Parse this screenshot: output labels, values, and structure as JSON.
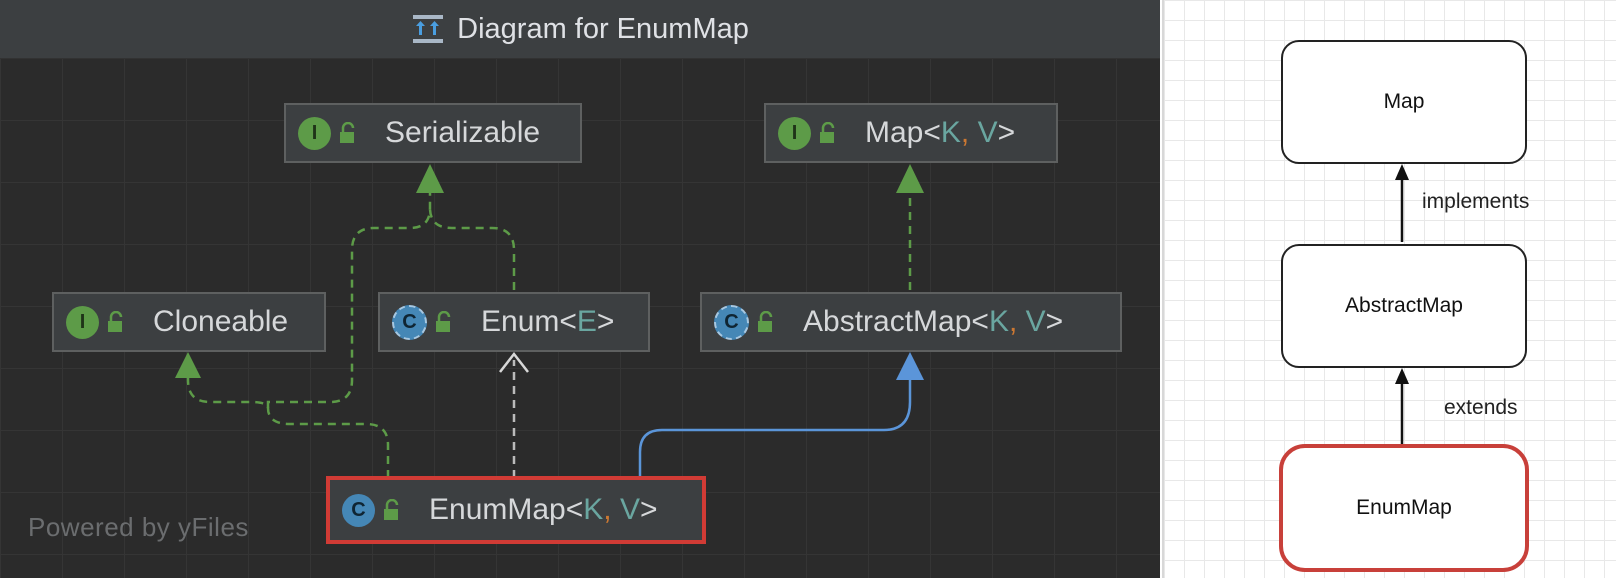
{
  "ide": {
    "title": "Diagram for EnumMap",
    "watermark": "Powered by yFiles",
    "nodes": {
      "serializable": {
        "kind": "interface",
        "badge": "I",
        "name": "Serializable"
      },
      "map": {
        "kind": "interface",
        "badge": "I",
        "name": "Map",
        "type_params": [
          "K",
          "V"
        ]
      },
      "cloneable": {
        "kind": "interface",
        "badge": "I",
        "name": "Cloneable"
      },
      "enum": {
        "kind": "abstract-class",
        "badge": "C",
        "name": "Enum",
        "type_params": [
          "E"
        ]
      },
      "abstractmap": {
        "kind": "abstract-class",
        "badge": "C",
        "name": "AbstractMap",
        "type_params": [
          "K",
          "V"
        ]
      },
      "enummap": {
        "kind": "class",
        "badge": "C",
        "name": "EnumMap",
        "type_params": [
          "K",
          "V"
        ],
        "selected": true
      }
    },
    "edges": [
      {
        "from": "enummap",
        "to": "cloneable",
        "style": "dashed",
        "color": "#5d9b48"
      },
      {
        "from": "enummap",
        "to": "serializable",
        "style": "dashed",
        "color": "#5d9b48"
      },
      {
        "from": "enum",
        "to": "serializable",
        "style": "dashed",
        "color": "#5d9b48"
      },
      {
        "from": "enummap",
        "to": "enum",
        "style": "dashed",
        "color": "#bbbbbb"
      },
      {
        "from": "abstractmap",
        "to": "map",
        "style": "dashed",
        "color": "#5d9b48"
      },
      {
        "from": "enummap",
        "to": "abstractmap",
        "style": "solid",
        "color": "#5b95d9"
      }
    ],
    "colors": {
      "background": "#2b2b2b",
      "interface_badge": "#5d9b48",
      "class_badge": "#4587b6",
      "selection": "#d13b35",
      "type_param": "#6aa6a0",
      "comma": "#cc7832"
    }
  },
  "drawio": {
    "boxes": {
      "map": "Map",
      "abstractmap": "AbstractMap",
      "enummap": "EnumMap"
    },
    "edge_labels": {
      "implements": "implements",
      "extends": "extends"
    },
    "colors": {
      "selection": "#c8403a"
    }
  }
}
